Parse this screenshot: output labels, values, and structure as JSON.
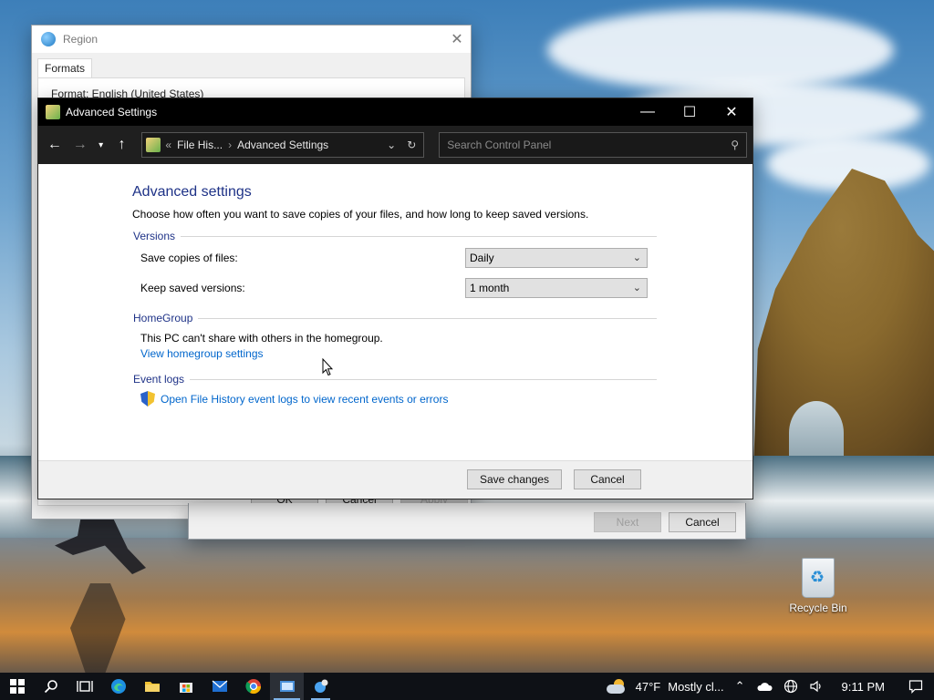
{
  "desktop": {
    "recycle_bin_label": "Recycle Bin"
  },
  "region_window": {
    "title": "Region",
    "tab_label": "Formats",
    "format_line": "Format: English (United States)",
    "buttons": {
      "ok": "OK",
      "cancel": "Cancel",
      "apply": "Apply"
    }
  },
  "wizard_window": {
    "buttons": {
      "next": "Next",
      "cancel": "Cancel"
    }
  },
  "advanced_window": {
    "title": "Advanced Settings",
    "breadcrumb": {
      "prefix": "«",
      "parent": "File His...",
      "current": "Advanced Settings"
    },
    "search_placeholder": "Search Control Panel",
    "heading": "Advanced settings",
    "description": "Choose how often you want to save copies of your files, and how long to keep saved versions.",
    "versions": {
      "title": "Versions",
      "save_copies_label": "Save copies of files:",
      "save_copies_value": "Daily",
      "keep_versions_label": "Keep saved versions:",
      "keep_versions_value": "1 month"
    },
    "homegroup": {
      "title": "HomeGroup",
      "text": "This PC can't share with others in the homegroup.",
      "link": "View homegroup settings"
    },
    "event_logs": {
      "title": "Event logs",
      "link": "Open File History event logs to view recent events or errors"
    },
    "footer": {
      "save": "Save changes",
      "cancel": "Cancel"
    }
  },
  "taskbar": {
    "weather_temp": "47°F",
    "weather_desc": "Mostly cl...",
    "time": "9:11 PM"
  },
  "colors": {
    "accent_link": "#0066cc",
    "heading_blue": "#1e3287",
    "titlebar_dark": "#000000"
  }
}
